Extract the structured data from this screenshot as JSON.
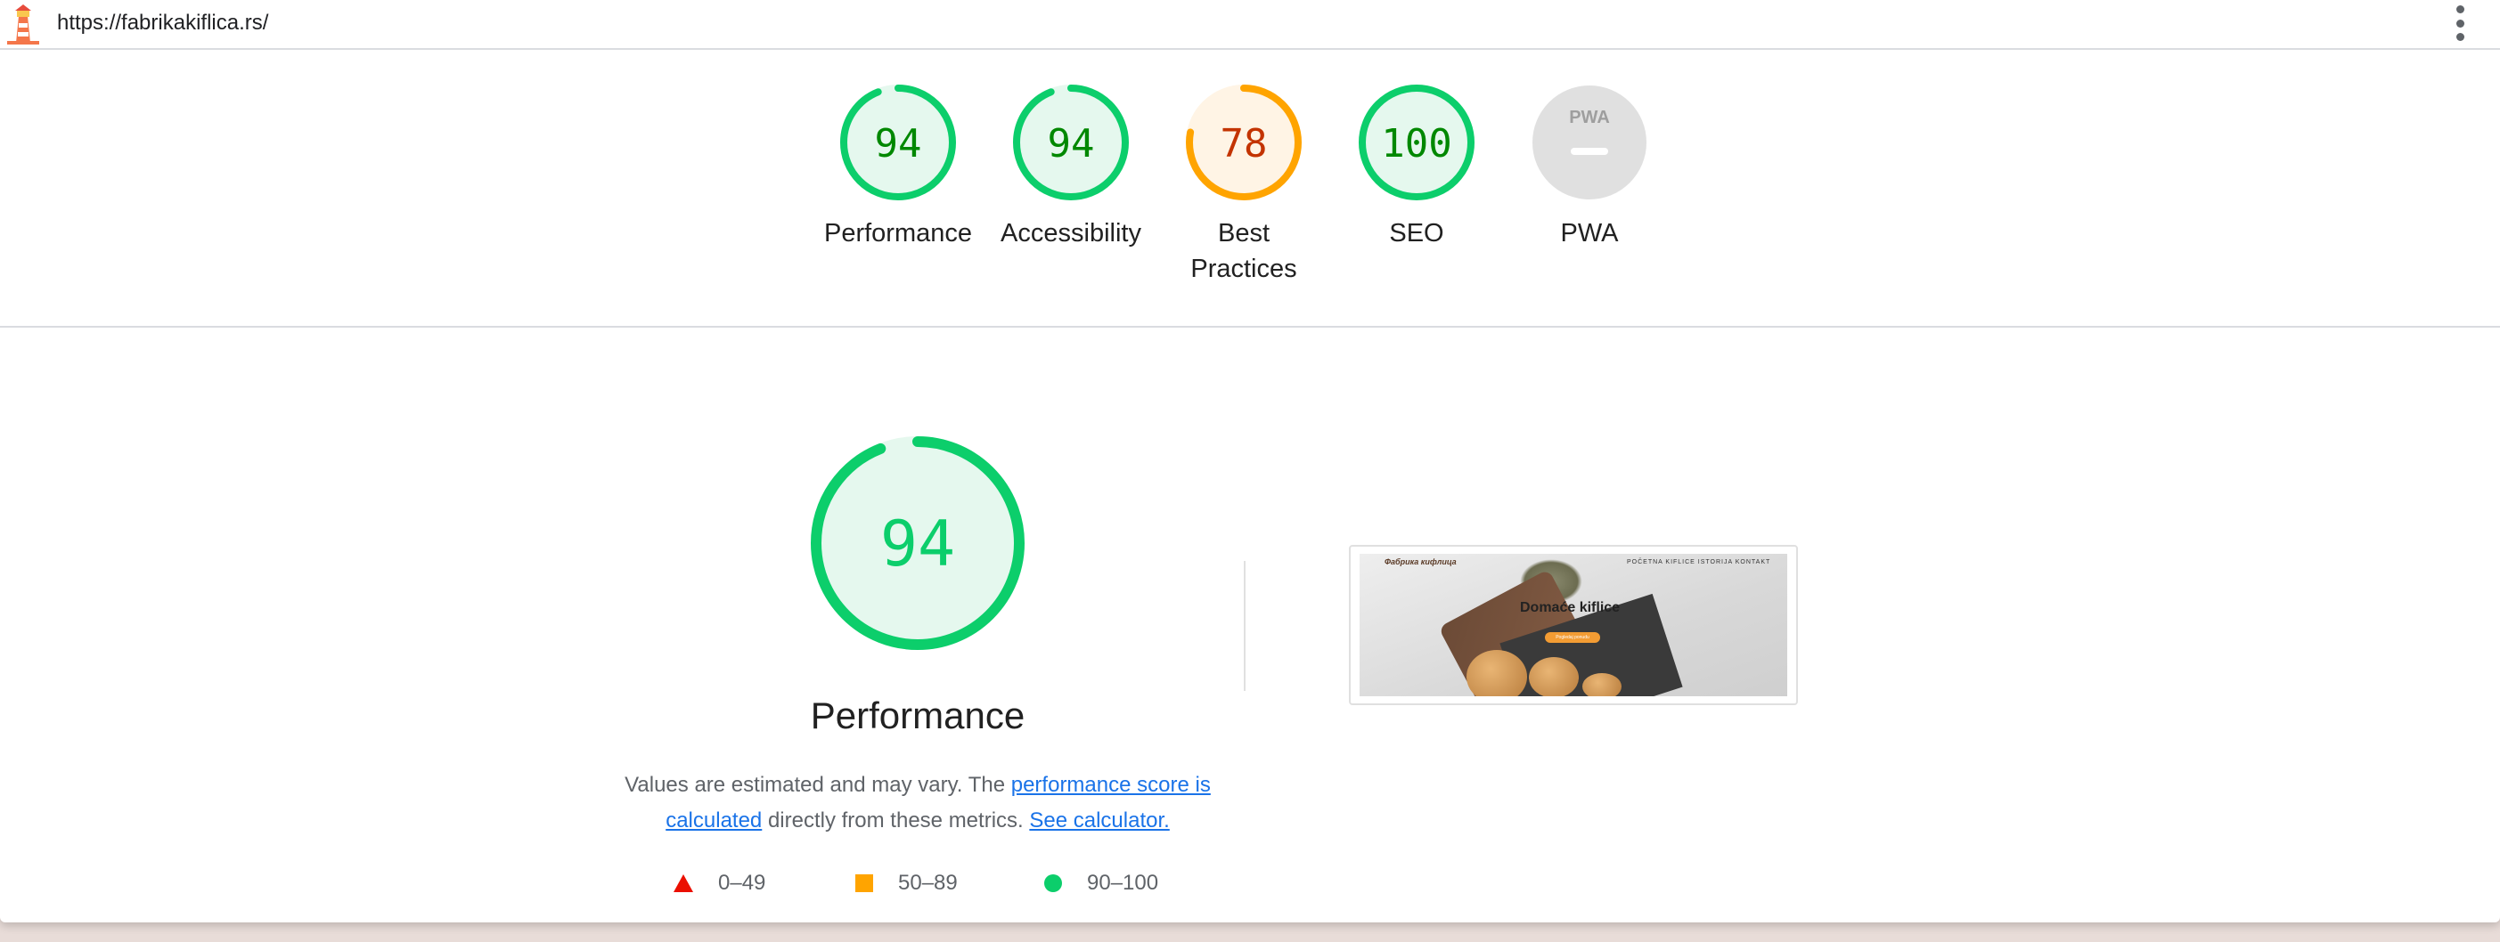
{
  "topbar": {
    "url": "https://fabrikakiflica.rs/",
    "logo_icon": "lighthouse-icon",
    "menu_icon": "more-vertical-icon"
  },
  "colors": {
    "pass": "#0cce6b",
    "pass_text": "#008800",
    "pass_fill": "#e5f8ee",
    "average": "#ffa400",
    "average_text": "#c33300",
    "average_fill": "#fff4e5",
    "fail": "#eb0f00",
    "na": "#e0e0e0",
    "link": "#1a73e8"
  },
  "categories": [
    {
      "name": "Performance",
      "score": "94",
      "fraction": 0.94,
      "rating": "pass"
    },
    {
      "name": "Accessibility",
      "score": "94",
      "fraction": 0.94,
      "rating": "pass"
    },
    {
      "name": "Best Practices",
      "score": "78",
      "fraction": 0.78,
      "rating": "average"
    },
    {
      "name": "SEO",
      "score": "100",
      "fraction": 1.0,
      "rating": "pass"
    },
    {
      "name": "PWA",
      "score": "",
      "fraction": 0,
      "rating": "na",
      "badge_text": "PWA"
    }
  ],
  "performance": {
    "score": "94",
    "fraction": 0.94,
    "title": "Performance",
    "desc_prefix": "Values are estimated and may vary. The",
    "link_score": "performance score is calculated",
    "desc_middle": "directly from these metrics.",
    "link_calc": "See calculator.",
    "legend": [
      {
        "icon": "triangle-icon",
        "range": "0–49"
      },
      {
        "icon": "square-icon",
        "range": "50–89"
      },
      {
        "icon": "circle-icon",
        "range": "90–100"
      }
    ]
  },
  "screenshot": {
    "brand": "Фабрика кифлица",
    "nav": "POČETNA  KIFLICE  ISTORIJA  KONTAKT",
    "headline": "Domaće kiflice",
    "cta": "Pogledaj ponudu"
  }
}
